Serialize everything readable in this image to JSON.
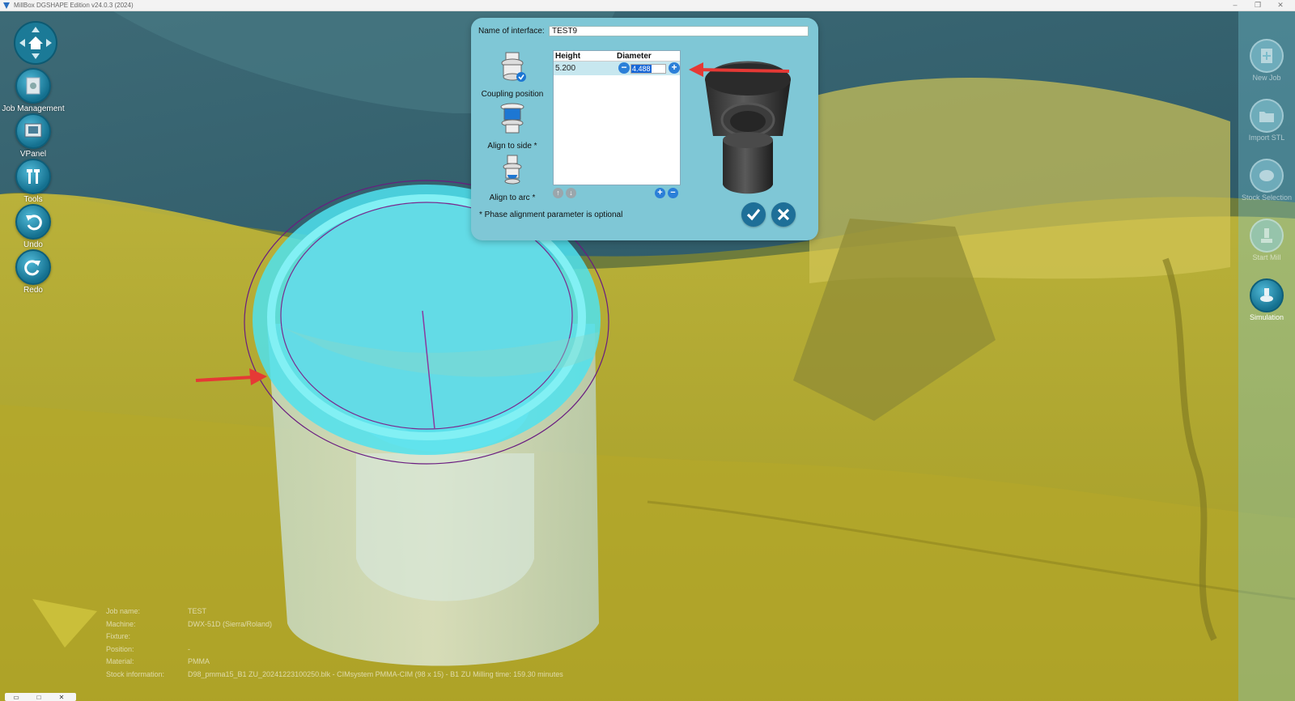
{
  "window": {
    "title": "MillBox DGSHAPE Edition v24.0.3 (2024)",
    "min_glyph": "–",
    "max_glyph": "❐",
    "close_glyph": "✕"
  },
  "left_toolbar": {
    "items": [
      {
        "label": "Job Management",
        "icon": "job-management-icon"
      },
      {
        "label": "VPanel",
        "icon": "vpanel-icon"
      },
      {
        "label": "Tools",
        "icon": "tools-icon"
      },
      {
        "label": "Undo",
        "icon": "undo-icon"
      },
      {
        "label": "Redo",
        "icon": "redo-icon"
      }
    ]
  },
  "right_toolbar": {
    "items": [
      {
        "label": "New Job",
        "icon": "new-job-icon",
        "active": false
      },
      {
        "label": "Import STL",
        "icon": "import-stl-icon",
        "active": false
      },
      {
        "label": "Stock Selection",
        "icon": "stock-selection-icon",
        "active": false
      },
      {
        "label": "Start Mill",
        "icon": "start-mill-icon",
        "active": false
      },
      {
        "label": "Simulation",
        "icon": "simulation-icon",
        "active": true
      }
    ]
  },
  "dialog": {
    "name_label": "Name of interface:",
    "name_value": "TEST9",
    "options": [
      {
        "label": "Coupling position",
        "icon": "coupling-position-icon"
      },
      {
        "label": "Align to side *",
        "icon": "align-to-side-icon"
      },
      {
        "label": "Align to arc *",
        "icon": "align-to-arc-icon"
      }
    ],
    "table": {
      "columns": [
        "Height",
        "Diameter"
      ],
      "rows": [
        {
          "height": "5.200",
          "diameter": "4.488"
        }
      ]
    },
    "note": "* Phase alignment parameter is optional",
    "minus_glyph": "−",
    "plus_glyph": "+",
    "up_glyph": "↑",
    "down_glyph": "↓"
  },
  "job_info": {
    "rows": [
      {
        "key": "Job name:",
        "value": "TEST"
      },
      {
        "key": "Machine:",
        "value": "DWX-51D (Sierra/Roland)"
      },
      {
        "key": "Fixture:",
        "value": ""
      },
      {
        "key": "Position:",
        "value": "-"
      },
      {
        "key": "Material:",
        "value": "PMMA"
      },
      {
        "key": "Stock information:",
        "value": "D98_pmma15_B1 ZU_20241223100250.blk - CIMsystem PMMA-CIM (98 x 15) - B1 ZU Milling time: 159.30 minutes"
      }
    ]
  },
  "mini_bar": {
    "a": "▭",
    "b": "□",
    "c": "✕"
  },
  "colors": {
    "dialog_bg": "#7fc7d6",
    "tool_blue": "#14708f",
    "accent_blue": "#2b7fd8",
    "arrow_red": "#e53935",
    "ring_cyan": "#5fe3ee"
  }
}
